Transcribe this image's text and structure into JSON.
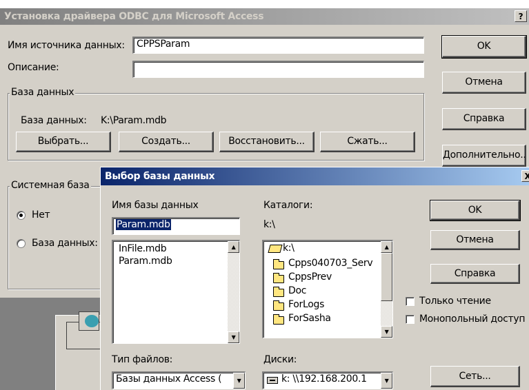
{
  "odbc": {
    "title": "Установка драйвера ODBC для Microsoft Access",
    "help_glyph": "?",
    "dsn_label": "Имя источника данных:",
    "dsn_value": "CPPSParam",
    "desc_label": "Описание:",
    "desc_value": "",
    "db_group": "База данных",
    "db_label": "База данных:",
    "db_value": "K:\\Param.mdb",
    "btn_select": "Выбрать...",
    "btn_create": "Создать...",
    "btn_restore": "Восстановить...",
    "btn_compact": "Сжать...",
    "btn_ok": "OK",
    "btn_cancel": "Отмена",
    "btn_help": "Справка",
    "btn_advanced": "Дополнительно...",
    "sys_group": "Системная база",
    "radio_none": "Нет",
    "radio_db": "База данных:"
  },
  "picker": {
    "title": "Выбор базы данных",
    "close_glyph": "X",
    "db_name_label": "Имя базы данных",
    "db_name_value": "Param.mdb",
    "files": [
      "InFile.mdb",
      "Param.mdb"
    ],
    "dirs_label": "Каталоги:",
    "dirs_path": "k:\\",
    "dirs": [
      "k:\\",
      "Cpps040703_Serv",
      "CppsPrev",
      "Doc",
      "ForLogs",
      "ForSasha"
    ],
    "filetype_label": "Тип файлов:",
    "filetype_value": "Базы данных Access (",
    "drives_label": "Диски:",
    "drives_value": "k: \\\\192.168.200.1",
    "btn_ok": "OK",
    "btn_cancel": "Отмена",
    "btn_help": "Справка",
    "btn_network": "Сеть...",
    "readonly_label": "Только чтение",
    "exclusive_label": "Монопольный доступ"
  },
  "colors": {
    "face": "#d4d0c8",
    "active_title": "#0a246a",
    "inactive_title": "#808080"
  }
}
